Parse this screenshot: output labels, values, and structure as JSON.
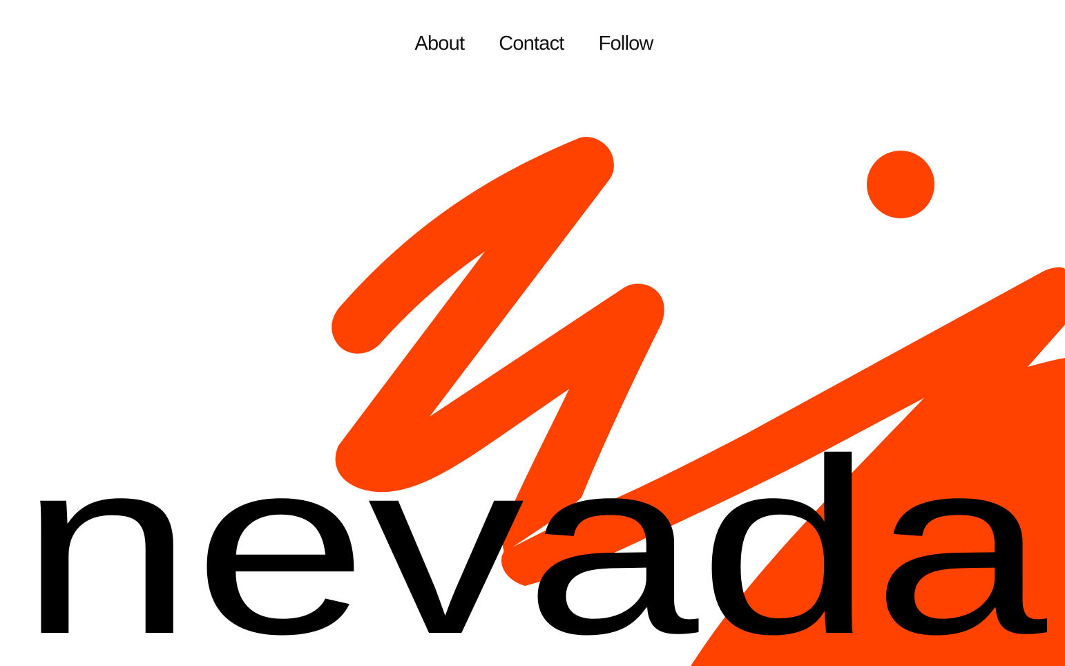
{
  "nav": {
    "items": [
      {
        "label": "About"
      },
      {
        "label": "Contact"
      },
      {
        "label": "Follow"
      }
    ]
  },
  "hero": {
    "wordmark": "nevada"
  },
  "colors": {
    "accent": "#FF4200",
    "text": "#000000",
    "background": "#FFFFFF"
  }
}
